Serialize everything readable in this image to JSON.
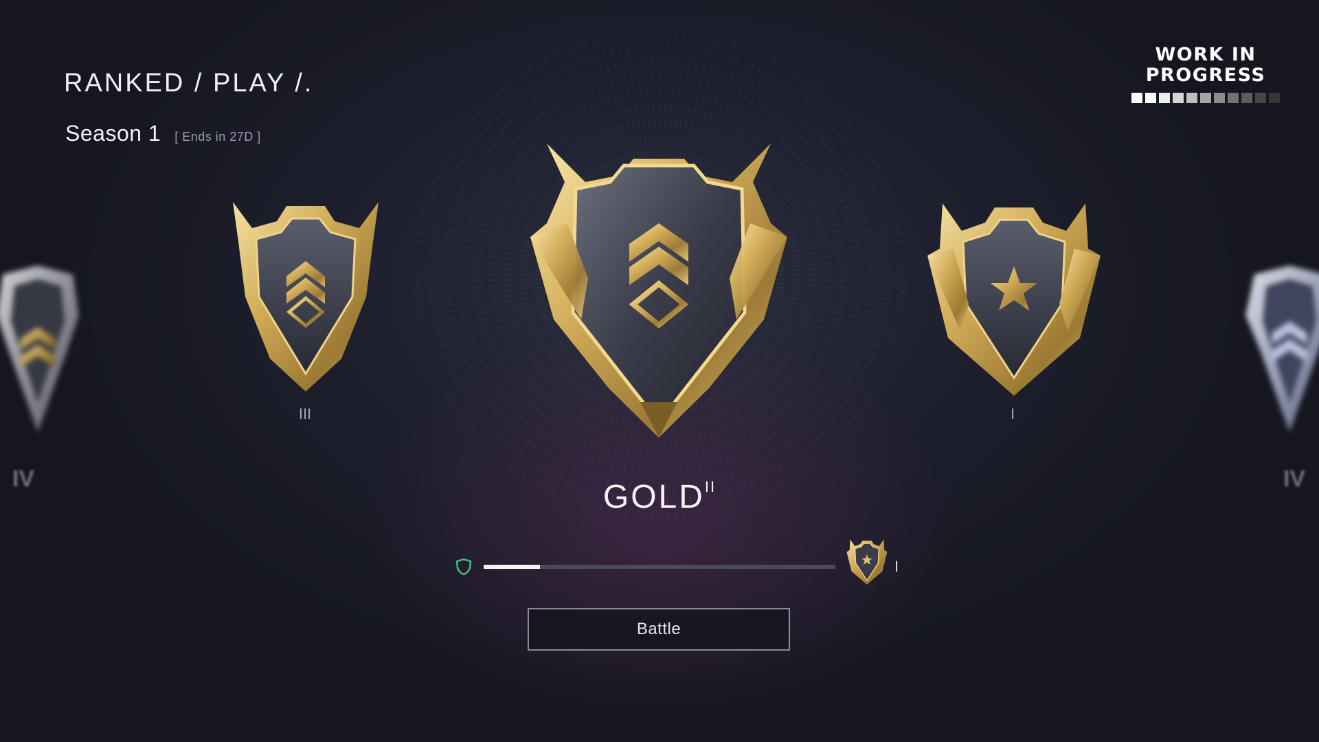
{
  "header": {
    "title": "RANKED / PLAY /."
  },
  "season": {
    "label": "Season 1",
    "ends": "[ Ends in 27D ]"
  },
  "wip": {
    "line1": "WORK IN",
    "line2": "PROGRESS",
    "bar_colors": [
      "#ffffff",
      "#ffffff",
      "#ececec",
      "#d6d6d6",
      "#bfbfbf",
      "#a6a6a6",
      "#8c8c8c",
      "#737373",
      "#5c5c5c",
      "#474747",
      "#353535"
    ]
  },
  "badges": {
    "far_left": {
      "icon": "silver-gold-badge-icon",
      "tier": "IV"
    },
    "left": {
      "icon": "gold-chevron-badge-icon",
      "tier": "III"
    },
    "center": {
      "icon": "gold-double-chevron-badge-icon"
    },
    "right": {
      "icon": "gold-star-badge-icon",
      "tier": "I"
    },
    "far_right": {
      "icon": "platinum-badge-icon",
      "tier": "IV"
    }
  },
  "rank": {
    "name": "GOLD",
    "tier": "II"
  },
  "progress": {
    "fraction": 0.16,
    "icon": "shield-outline-icon",
    "next_icon": "gold-star-badge-icon",
    "next_tier": "I"
  },
  "actions": {
    "battle_label": "Battle"
  },
  "colors": {
    "gold": "#c9a552",
    "accent_green": "#3fbf7f",
    "background": "#1c1d2a"
  }
}
